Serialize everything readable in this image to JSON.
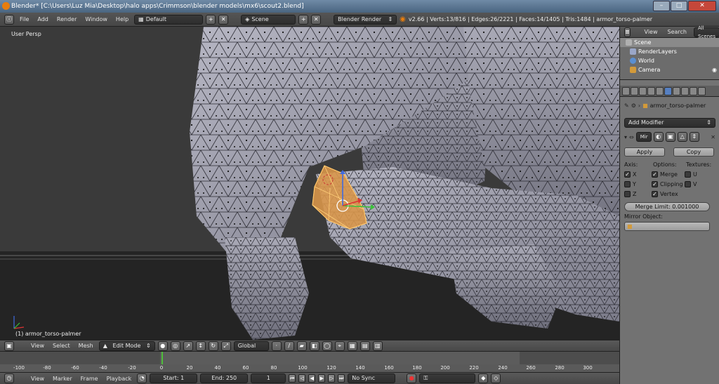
{
  "titlebar": {
    "title": "Blender* [C:\\Users\\Luz Mia\\Desktop\\halo apps\\Crimmson\\blender models\\mx6\\scout2.blend]"
  },
  "info_menu": [
    "File",
    "Add",
    "Render",
    "Window",
    "Help"
  ],
  "screen_layout": "Default",
  "scene": "Scene",
  "render_engine": "Blender Render",
  "stats": "v2.66 | Verts:13/816 | Edges:26/2221 | Faces:14/1405 | Tris:1484 | armor_torso-palmer",
  "viewport": {
    "view_label": "User Persp",
    "object_label": "(1) armor_torso-palmer"
  },
  "outliner": {
    "header": [
      "View",
      "Search",
      "All Scenes"
    ],
    "rows": [
      {
        "label": "Scene",
        "color": "#b0b0b0"
      },
      {
        "label": "RenderLayers",
        "color": "#9aa7c8"
      },
      {
        "label": "World",
        "color": "#5b8fd1"
      },
      {
        "label": "Camera",
        "color": "#d39a3a"
      }
    ]
  },
  "properties": {
    "object_name": "armor_torso-palmer",
    "add_modifier": "Add Modifier",
    "modifier_name": "Mir",
    "apply": "Apply",
    "copy": "Copy",
    "axis_label": "Axis:",
    "options_label": "Options:",
    "textures_label": "Textures:",
    "axes": [
      {
        "label": "X",
        "checked": true
      },
      {
        "label": "Y",
        "checked": false
      },
      {
        "label": "Z",
        "checked": false
      }
    ],
    "options": [
      {
        "label": "Merge",
        "checked": true
      },
      {
        "label": "Clipping",
        "checked": true
      },
      {
        "label": "Vertex",
        "checked": true
      }
    ],
    "textures": [
      {
        "label": "U",
        "checked": false
      },
      {
        "label": "V",
        "checked": false
      }
    ],
    "merge_limit": "Merge Limit: 0.001000",
    "mirror_object": "Mirror Object:"
  },
  "viewport_header": {
    "menus": [
      "View",
      "Select",
      "Mesh"
    ],
    "mode": "Edit Mode",
    "orientation": "Global"
  },
  "timeline": {
    "ticks": [
      "-100",
      "-80",
      "-60",
      "-40",
      "-20",
      "0",
      "20",
      "40",
      "60",
      "80",
      "100",
      "120",
      "140",
      "160",
      "180",
      "200",
      "220",
      "240",
      "260",
      "280",
      "300"
    ],
    "menus": [
      "View",
      "Marker",
      "Frame",
      "Playback"
    ],
    "start": "Start: 1",
    "end": "End: 250",
    "current": "1",
    "sync": "No Sync"
  }
}
